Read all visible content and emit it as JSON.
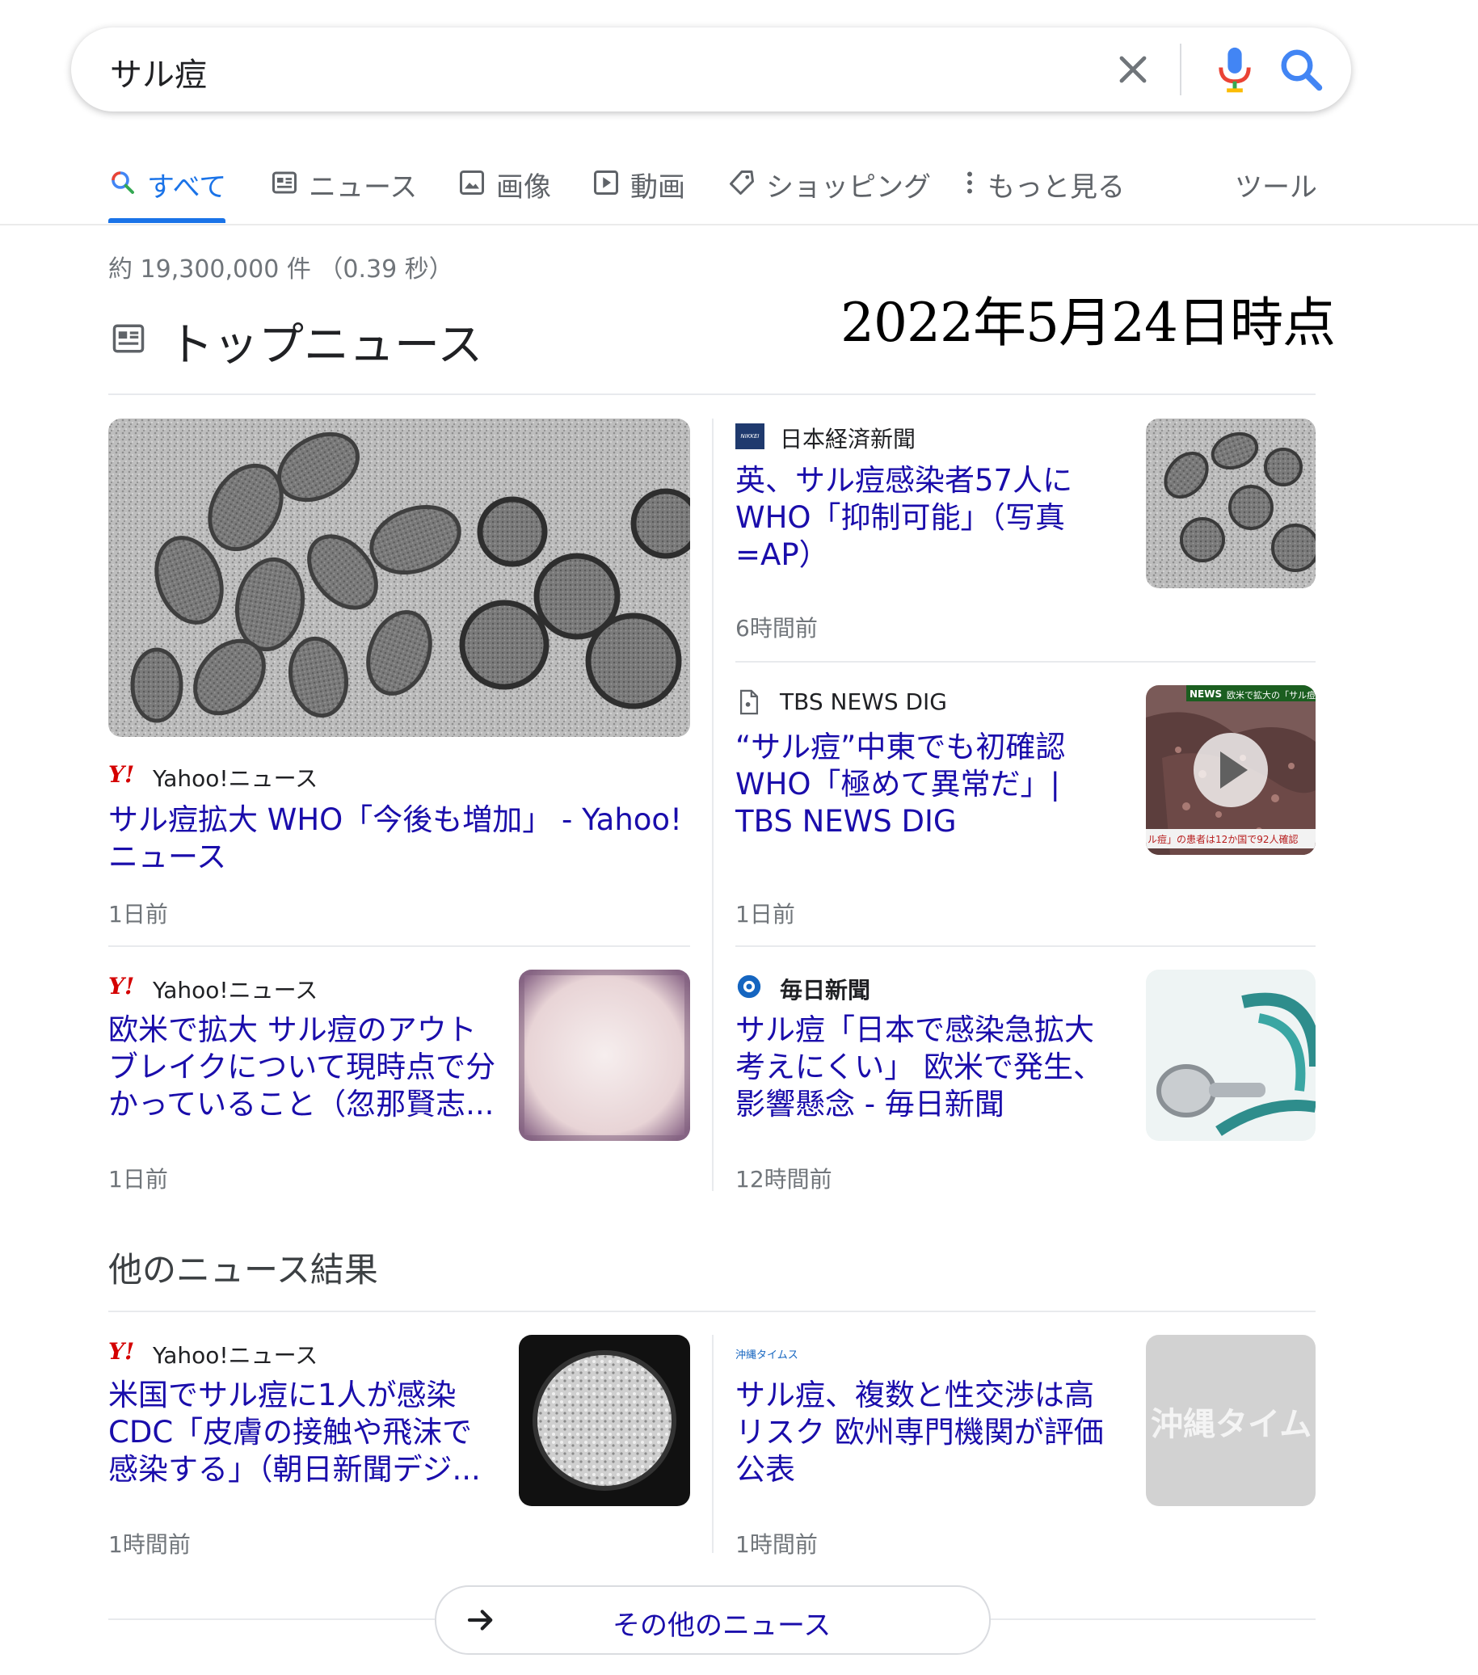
{
  "search": {
    "query": "サル痘"
  },
  "tabs": [
    {
      "label": "すべて",
      "icon": "search-icon",
      "active": true
    },
    {
      "label": "ニュース",
      "icon": "news-icon"
    },
    {
      "label": "画像",
      "icon": "image-icon"
    },
    {
      "label": "動画",
      "icon": "video-icon"
    },
    {
      "label": "ショッピング",
      "icon": "tag-icon"
    },
    {
      "label": "もっと見る",
      "icon": "more-vert-icon"
    }
  ],
  "tools_label": "ツール",
  "result_stats": "約 19,300,000 件 （0.39 秒）",
  "date_annotation": "2022年5月24日時点",
  "top_news": {
    "title": "トップニュース",
    "cards": [
      {
        "source": "Yahoo!ニュース",
        "source_logo": "Y!",
        "headline": "サル痘拡大 WHO「今後も増加」 - Yahoo! ニュース",
        "age": "1日前"
      },
      {
        "source": "日本経済新聞",
        "source_logo": "NIKKEI",
        "headline": "英、サル痘感染者57人に WHO「抑制可能」（写真=AP）",
        "age": "6時間前"
      },
      {
        "source": "TBS NEWS DIG",
        "headline": "“サル痘”中東でも初確認 WHO「極めて異常だ」| TBS NEWS DIG",
        "age": "1日前",
        "thumb_text_1": "NEWS",
        "thumb_text_2": "欧米で拡大の「サル痘",
        "thumb_text_3": "ル痘」の患者は12か国で92人確認"
      },
      {
        "source": "Yahoo!ニュース",
        "source_logo": "Y!",
        "headline": "欧米で拡大 サル痘のアウトブレイクについて現時点で分かっていること（忽那賢志...",
        "age": "1日前"
      },
      {
        "source": "毎日新聞",
        "headline": "サル痘「日本で感染急拡大考えにくい」 欧米で発生、影響懸念 - 毎日新聞",
        "age": "12時間前"
      }
    ]
  },
  "other_news": {
    "title": "他のニュース結果",
    "cards": [
      {
        "source": "Yahoo!ニュース",
        "source_logo": "Y!",
        "headline": "米国でサル痘に1人が感染 CDC「皮膚の接触や飛沫で感染する」（朝日新聞デジ...",
        "age": "1時間前"
      },
      {
        "source_logo": "沖縄タイムス",
        "headline": "サル痘、複数と性交渉は高リスク 欧州専門機関が評価公表",
        "age": "1時間前",
        "thumb_text": "沖縄タイム"
      }
    ]
  },
  "more_news_button": "その他のニュース",
  "colors": {
    "link": "#1a0dab",
    "accent": "#1a73e8",
    "meta": "#70757a"
  }
}
